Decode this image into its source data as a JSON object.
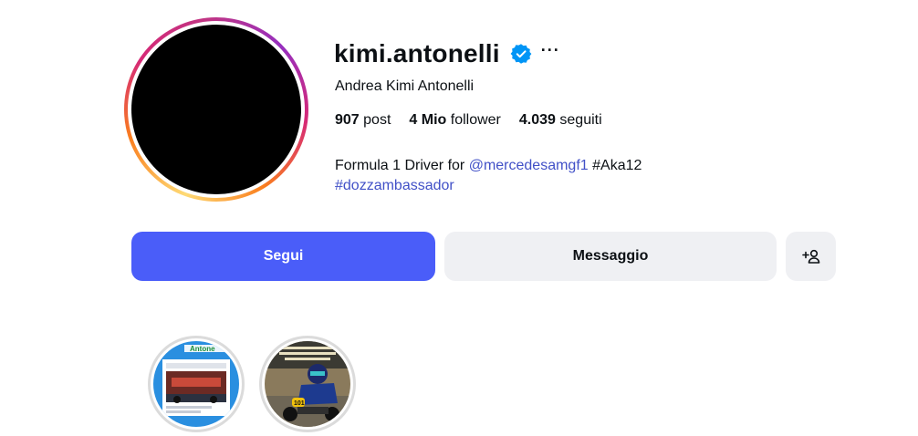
{
  "profile": {
    "username": "kimi.antonelli",
    "verified": true,
    "more_label": "···",
    "full_name": "Andrea Kimi Antonelli",
    "stats": [
      {
        "value": "907",
        "label": "post"
      },
      {
        "value": "4 Mio",
        "label": "follower"
      },
      {
        "value": "4.039",
        "label": "seguiti"
      }
    ],
    "bio": {
      "line1_prefix": "Formula 1 Driver for ",
      "mention": "@mercedesamgf1",
      "line1_suffix": " #Aka12",
      "hashtag": "#dozzambassador"
    }
  },
  "actions": {
    "follow_label": "Segui",
    "message_label": "Messaggio",
    "suggest_icon": "person-add-icon"
  },
  "colors": {
    "follow_button": "#4a5df9",
    "secondary_button": "#eff0f3",
    "link": "#4150c7",
    "verified_badge": "#0095f6"
  },
  "highlights": [
    {
      "icon": "highlight-cover-image"
    },
    {
      "icon": "highlight-cover-image"
    }
  ]
}
